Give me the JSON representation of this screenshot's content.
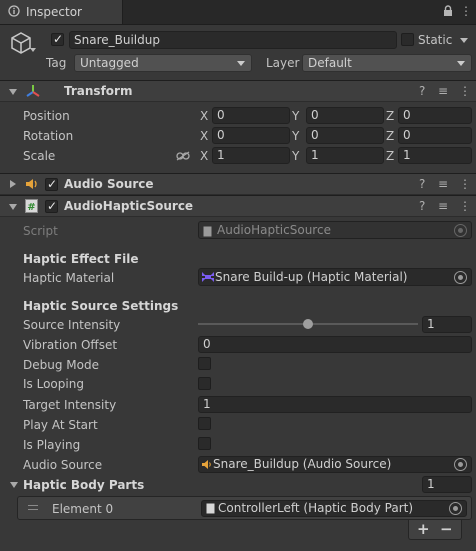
{
  "tab": {
    "title": "Inspector"
  },
  "gameobject": {
    "active": true,
    "name": "Snare_Buildup",
    "static_label": "Static",
    "tag_label": "Tag",
    "tag_value": "Untagged",
    "layer_label": "Layer",
    "layer_value": "Default"
  },
  "transform": {
    "title": "Transform",
    "rows": [
      {
        "label": "Position",
        "x": "0",
        "y": "0",
        "z": "0"
      },
      {
        "label": "Rotation",
        "x": "0",
        "y": "0",
        "z": "0"
      },
      {
        "label": "Scale",
        "x": "1",
        "y": "1",
        "z": "1"
      }
    ],
    "axes": {
      "x": "X",
      "y": "Y",
      "z": "Z"
    }
  },
  "audio_source_component": {
    "title": "Audio Source",
    "enabled": true
  },
  "haptic_component": {
    "title": "AudioHapticSource",
    "enabled": true,
    "script_label": "Script",
    "script_value": "AudioHapticSource",
    "section_effect": "Haptic Effect File",
    "haptic_material_label": "Haptic Material",
    "haptic_material_value": "Snare Build-up (Haptic Material)",
    "section_settings": "Haptic Source Settings",
    "source_intensity_label": "Source Intensity",
    "source_intensity_value": "1",
    "source_intensity_slider": 0.5,
    "vibration_offset_label": "Vibration Offset",
    "vibration_offset_value": "0",
    "debug_mode_label": "Debug Mode",
    "is_looping_label": "Is Looping",
    "target_intensity_label": "Target Intensity",
    "target_intensity_value": "1",
    "play_at_start_label": "Play At Start",
    "is_playing_label": "Is Playing",
    "audio_source_label": "Audio Source",
    "audio_source_value": "Snare_Buildup (Audio Source)",
    "body_parts_label": "Haptic Body Parts",
    "body_parts_count": "1",
    "element_label": "Element 0",
    "element_value": "ControllerLeft (Haptic Body Part)",
    "add_label": "+",
    "remove_label": "−"
  },
  "icons": {
    "header_help": "?",
    "header_presets": "≡",
    "header_menu": "⋮",
    "lock": "🔒",
    "gameobject": "cube-icon",
    "transform": "transform-axes-icon",
    "audio": "speaker-icon",
    "script": "script-icon"
  },
  "colors": {
    "panel": "#383838",
    "field": "#2a2a2a",
    "header": "#3e3e3e",
    "material_icon": "#7a5cf0",
    "audio_icon": "#e6a33a"
  }
}
